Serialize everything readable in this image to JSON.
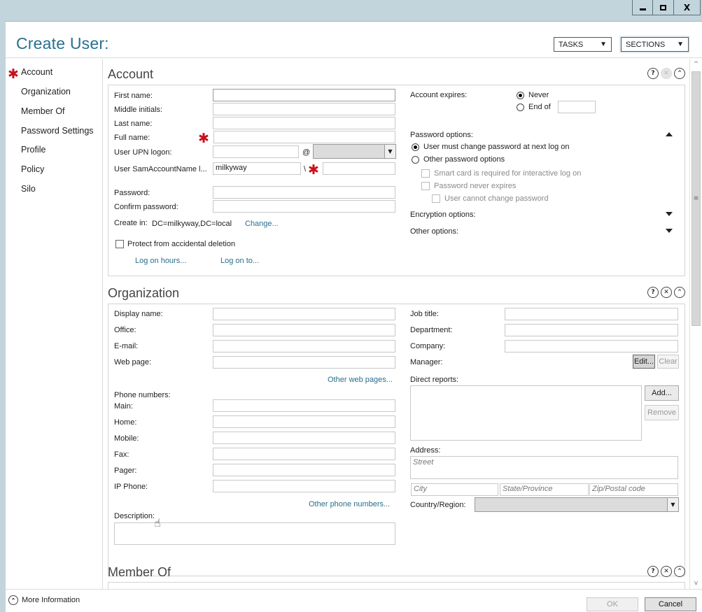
{
  "window": {
    "minimize_glyph": "minimize",
    "maximize_glyph": "maximize",
    "close_label": "X"
  },
  "header": {
    "title": "Create User:",
    "tasks_label": "TASKS",
    "sections_label": "SECTIONS",
    "dropdown_arrow": "▼"
  },
  "sidebar": {
    "items": [
      {
        "label": "Account",
        "required": true
      },
      {
        "label": "Organization"
      },
      {
        "label": "Member Of"
      },
      {
        "label": "Password Settings"
      },
      {
        "label": "Profile"
      },
      {
        "label": "Policy"
      },
      {
        "label": "Silo"
      }
    ],
    "required_marker": "✱"
  },
  "icons": {
    "help": "?",
    "close": "✕",
    "collapse": "⌃"
  },
  "account": {
    "title": "Account",
    "first_name_label": "First name:",
    "middle_initials_label": "Middle initials:",
    "last_name_label": "Last name:",
    "full_name_label": "Full name:",
    "upn_label": "User UPN logon:",
    "upn_at": "@",
    "sam_label": "User SamAccountName l...",
    "sam_domain_value": "milkyway",
    "sam_separator": "\\",
    "password_label": "Password:",
    "confirm_password_label": "Confirm password:",
    "create_in_label": "Create in:",
    "create_in_value": "DC=milkyway,DC=local",
    "change_link": "Change...",
    "protect_label": "Protect from accidental deletion",
    "protect_checked": false,
    "log_on_hours_link": "Log on hours...",
    "log_on_to_link": "Log on to...",
    "account_expires_label": "Account expires:",
    "expires_never": "Never",
    "expires_end_of": "End of",
    "expires_selected": "Never",
    "password_options_label": "Password options:",
    "pw_must_change": "User must change password at next log on",
    "pw_other": "Other password options",
    "pw_selected": "User must change password at next log on",
    "smart_card": "Smart card is required for interactive log on",
    "never_expires": "Password never expires",
    "cannot_change": "User cannot change password",
    "encryption_label": "Encryption options:",
    "other_options_label": "Other options:"
  },
  "organization": {
    "title": "Organization",
    "display_name_label": "Display name:",
    "office_label": "Office:",
    "email_label": "E-mail:",
    "web_page_label": "Web page:",
    "other_web_link": "Other web pages...",
    "phone_numbers_label": "Phone numbers:",
    "main_label": "Main:",
    "home_label": "Home:",
    "mobile_label": "Mobile:",
    "fax_label": "Fax:",
    "pager_label": "Pager:",
    "ip_phone_label": "IP Phone:",
    "other_phone_link": "Other phone numbers...",
    "description_label": "Description:",
    "job_title_label": "Job title:",
    "department_label": "Department:",
    "company_label": "Company:",
    "manager_label": "Manager:",
    "edit_button": "Edit...",
    "clear_button": "Clear",
    "direct_reports_label": "Direct reports:",
    "add_button": "Add...",
    "remove_button": "Remove",
    "address_label": "Address:",
    "street_placeholder": "Street",
    "city_placeholder": "City",
    "state_placeholder": "State/Province",
    "zip_placeholder": "Zip/Postal code",
    "country_label": "Country/Region:"
  },
  "member_of": {
    "title": "Member Of"
  },
  "scrollbar": {
    "up": "^",
    "down": "v",
    "grip": "≡"
  },
  "footer": {
    "more_info_label": "More Information",
    "ok_label": "OK",
    "cancel_label": "Cancel"
  },
  "cursor": "☝"
}
